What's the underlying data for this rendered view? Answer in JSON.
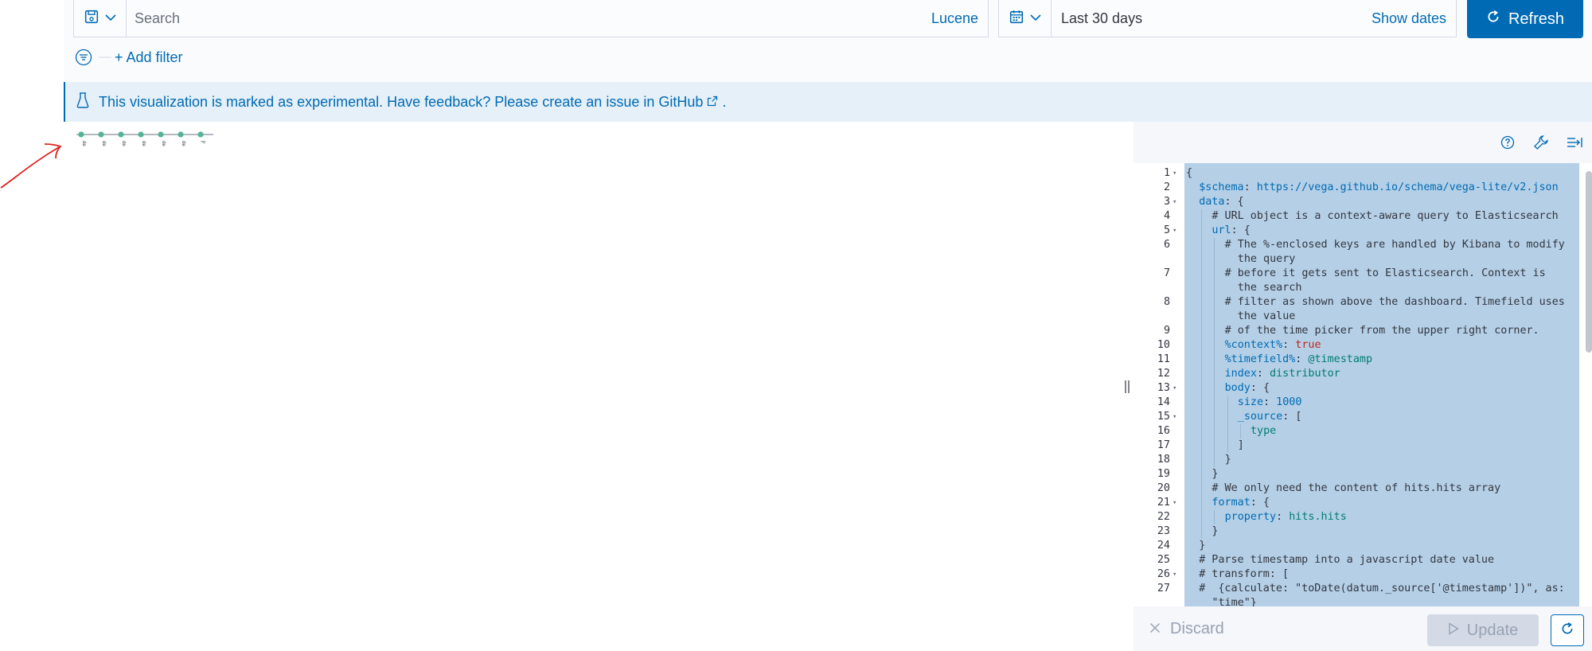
{
  "query_bar": {
    "search_placeholder": "Search",
    "language_label": "Lucene",
    "save_icon": "save-icon",
    "date_range_label": "Last 30 days",
    "show_dates_label": "Show dates",
    "refresh_label": "Refresh",
    "add_filter_label": "+ Add filter"
  },
  "callout": {
    "text": "This visualization is marked as experimental. Have feedback? Please create an issue in GitHub",
    "suffix": "."
  },
  "editor": {
    "lines": [
      {
        "n": "1",
        "fold": true,
        "indent": 0,
        "parts": [
          [
            "c",
            "{"
          ]
        ]
      },
      {
        "n": "2",
        "fold": false,
        "indent": 1,
        "parts": [
          [
            "k",
            "$schema"
          ],
          [
            "c",
            ": "
          ],
          [
            "n",
            "https://vega.github.io/schema/vega-lite/v2.json"
          ]
        ]
      },
      {
        "n": "3",
        "fold": true,
        "indent": 1,
        "parts": [
          [
            "k",
            "data"
          ],
          [
            "c",
            ": {"
          ]
        ]
      },
      {
        "n": "4",
        "fold": false,
        "indent": 2,
        "parts": [
          [
            "c",
            "# URL object is a context-aware query to Elasticsearch"
          ]
        ]
      },
      {
        "n": "5",
        "fold": true,
        "indent": 2,
        "parts": [
          [
            "k",
            "url"
          ],
          [
            "c",
            ": {"
          ]
        ]
      },
      {
        "n": "6",
        "fold": false,
        "indent": 3,
        "parts": [
          [
            "c",
            "# The %-enclosed keys are handled by Kibana to modify"
          ]
        ],
        "wrap": "the query"
      },
      {
        "n": "7",
        "fold": false,
        "indent": 3,
        "parts": [
          [
            "c",
            "# before it gets sent to Elasticsearch. Context is"
          ]
        ],
        "wrap": "the search"
      },
      {
        "n": "8",
        "fold": false,
        "indent": 3,
        "parts": [
          [
            "c",
            "# filter as shown above the dashboard. Timefield uses"
          ]
        ],
        "wrap": "the value"
      },
      {
        "n": "9",
        "fold": false,
        "indent": 3,
        "parts": [
          [
            "c",
            "# of the time picker from the upper right corner."
          ]
        ]
      },
      {
        "n": "10",
        "fold": false,
        "indent": 3,
        "parts": [
          [
            "k",
            "%context%"
          ],
          [
            "c",
            ": "
          ],
          [
            "t",
            "true"
          ]
        ]
      },
      {
        "n": "11",
        "fold": false,
        "indent": 3,
        "parts": [
          [
            "k",
            "%timefield%"
          ],
          [
            "c",
            ": "
          ],
          [
            "v",
            "@timestamp"
          ]
        ]
      },
      {
        "n": "12",
        "fold": false,
        "indent": 3,
        "parts": [
          [
            "k",
            "index"
          ],
          [
            "c",
            ": "
          ],
          [
            "v",
            "distributor"
          ]
        ]
      },
      {
        "n": "13",
        "fold": true,
        "indent": 3,
        "parts": [
          [
            "k",
            "body"
          ],
          [
            "c",
            ": {"
          ]
        ]
      },
      {
        "n": "14",
        "fold": false,
        "indent": 4,
        "parts": [
          [
            "k",
            "size"
          ],
          [
            "c",
            ": "
          ],
          [
            "n",
            "1000"
          ]
        ]
      },
      {
        "n": "15",
        "fold": true,
        "indent": 4,
        "parts": [
          [
            "k",
            "_source"
          ],
          [
            "c",
            ": ["
          ]
        ]
      },
      {
        "n": "16",
        "fold": false,
        "indent": 5,
        "parts": [
          [
            "v",
            "type"
          ]
        ]
      },
      {
        "n": "17",
        "fold": false,
        "indent": 4,
        "parts": [
          [
            "c",
            "]"
          ]
        ]
      },
      {
        "n": "18",
        "fold": false,
        "indent": 3,
        "parts": [
          [
            "c",
            "}"
          ]
        ]
      },
      {
        "n": "19",
        "fold": false,
        "indent": 2,
        "parts": [
          [
            "c",
            "}"
          ]
        ]
      },
      {
        "n": "20",
        "fold": false,
        "indent": 2,
        "parts": [
          [
            "c",
            "# We only need the content of hits.hits array"
          ]
        ]
      },
      {
        "n": "21",
        "fold": true,
        "indent": 2,
        "parts": [
          [
            "k",
            "format"
          ],
          [
            "c",
            ": {"
          ]
        ]
      },
      {
        "n": "22",
        "fold": false,
        "indent": 3,
        "parts": [
          [
            "k",
            "property"
          ],
          [
            "c",
            ": "
          ],
          [
            "v",
            "hits.hits"
          ]
        ]
      },
      {
        "n": "23",
        "fold": false,
        "indent": 2,
        "parts": [
          [
            "c",
            "}"
          ]
        ]
      },
      {
        "n": "24",
        "fold": false,
        "indent": 1,
        "parts": [
          [
            "c",
            "}"
          ]
        ]
      },
      {
        "n": "25",
        "fold": false,
        "indent": 1,
        "parts": [
          [
            "c",
            "# Parse timestamp into a javascript date value"
          ]
        ]
      },
      {
        "n": "26",
        "fold": true,
        "indent": 1,
        "parts": [
          [
            "c",
            "# transform: ["
          ]
        ]
      },
      {
        "n": "27",
        "fold": false,
        "indent": 1,
        "parts": [
          [
            "c",
            "#  {calculate: \"toDate(datum._source['@timestamp'])\", as:"
          ]
        ],
        "wrap": "\"time\"}"
      }
    ],
    "discard_label": "Discard",
    "update_label": "Update"
  },
  "viz": {
    "points": 7,
    "tick_labels": [
      "de",
      "de",
      "de",
      "de",
      "de",
      "de",
      "jr"
    ]
  }
}
